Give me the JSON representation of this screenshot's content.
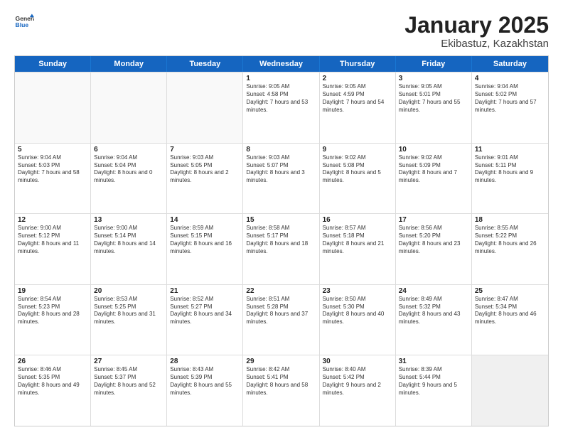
{
  "header": {
    "logo": {
      "general": "General",
      "blue": "Blue"
    },
    "title": "January 2025",
    "location": "Ekibastuz, Kazakhstan"
  },
  "weekdays": [
    "Sunday",
    "Monday",
    "Tuesday",
    "Wednesday",
    "Thursday",
    "Friday",
    "Saturday"
  ],
  "rows": [
    [
      {
        "day": "",
        "text": "",
        "empty": true
      },
      {
        "day": "",
        "text": "",
        "empty": true
      },
      {
        "day": "",
        "text": "",
        "empty": true
      },
      {
        "day": "1",
        "text": "Sunrise: 9:05 AM\nSunset: 4:58 PM\nDaylight: 7 hours and 53 minutes."
      },
      {
        "day": "2",
        "text": "Sunrise: 9:05 AM\nSunset: 4:59 PM\nDaylight: 7 hours and 54 minutes."
      },
      {
        "day": "3",
        "text": "Sunrise: 9:05 AM\nSunset: 5:01 PM\nDaylight: 7 hours and 55 minutes."
      },
      {
        "day": "4",
        "text": "Sunrise: 9:04 AM\nSunset: 5:02 PM\nDaylight: 7 hours and 57 minutes."
      }
    ],
    [
      {
        "day": "5",
        "text": "Sunrise: 9:04 AM\nSunset: 5:03 PM\nDaylight: 7 hours and 58 minutes."
      },
      {
        "day": "6",
        "text": "Sunrise: 9:04 AM\nSunset: 5:04 PM\nDaylight: 8 hours and 0 minutes."
      },
      {
        "day": "7",
        "text": "Sunrise: 9:03 AM\nSunset: 5:05 PM\nDaylight: 8 hours and 2 minutes."
      },
      {
        "day": "8",
        "text": "Sunrise: 9:03 AM\nSunset: 5:07 PM\nDaylight: 8 hours and 3 minutes."
      },
      {
        "day": "9",
        "text": "Sunrise: 9:02 AM\nSunset: 5:08 PM\nDaylight: 8 hours and 5 minutes."
      },
      {
        "day": "10",
        "text": "Sunrise: 9:02 AM\nSunset: 5:09 PM\nDaylight: 8 hours and 7 minutes."
      },
      {
        "day": "11",
        "text": "Sunrise: 9:01 AM\nSunset: 5:11 PM\nDaylight: 8 hours and 9 minutes."
      }
    ],
    [
      {
        "day": "12",
        "text": "Sunrise: 9:00 AM\nSunset: 5:12 PM\nDaylight: 8 hours and 11 minutes."
      },
      {
        "day": "13",
        "text": "Sunrise: 9:00 AM\nSunset: 5:14 PM\nDaylight: 8 hours and 14 minutes."
      },
      {
        "day": "14",
        "text": "Sunrise: 8:59 AM\nSunset: 5:15 PM\nDaylight: 8 hours and 16 minutes."
      },
      {
        "day": "15",
        "text": "Sunrise: 8:58 AM\nSunset: 5:17 PM\nDaylight: 8 hours and 18 minutes."
      },
      {
        "day": "16",
        "text": "Sunrise: 8:57 AM\nSunset: 5:18 PM\nDaylight: 8 hours and 21 minutes."
      },
      {
        "day": "17",
        "text": "Sunrise: 8:56 AM\nSunset: 5:20 PM\nDaylight: 8 hours and 23 minutes."
      },
      {
        "day": "18",
        "text": "Sunrise: 8:55 AM\nSunset: 5:22 PM\nDaylight: 8 hours and 26 minutes."
      }
    ],
    [
      {
        "day": "19",
        "text": "Sunrise: 8:54 AM\nSunset: 5:23 PM\nDaylight: 8 hours and 28 minutes."
      },
      {
        "day": "20",
        "text": "Sunrise: 8:53 AM\nSunset: 5:25 PM\nDaylight: 8 hours and 31 minutes."
      },
      {
        "day": "21",
        "text": "Sunrise: 8:52 AM\nSunset: 5:27 PM\nDaylight: 8 hours and 34 minutes."
      },
      {
        "day": "22",
        "text": "Sunrise: 8:51 AM\nSunset: 5:28 PM\nDaylight: 8 hours and 37 minutes."
      },
      {
        "day": "23",
        "text": "Sunrise: 8:50 AM\nSunset: 5:30 PM\nDaylight: 8 hours and 40 minutes."
      },
      {
        "day": "24",
        "text": "Sunrise: 8:49 AM\nSunset: 5:32 PM\nDaylight: 8 hours and 43 minutes."
      },
      {
        "day": "25",
        "text": "Sunrise: 8:47 AM\nSunset: 5:34 PM\nDaylight: 8 hours and 46 minutes."
      }
    ],
    [
      {
        "day": "26",
        "text": "Sunrise: 8:46 AM\nSunset: 5:35 PM\nDaylight: 8 hours and 49 minutes."
      },
      {
        "day": "27",
        "text": "Sunrise: 8:45 AM\nSunset: 5:37 PM\nDaylight: 8 hours and 52 minutes."
      },
      {
        "day": "28",
        "text": "Sunrise: 8:43 AM\nSunset: 5:39 PM\nDaylight: 8 hours and 55 minutes."
      },
      {
        "day": "29",
        "text": "Sunrise: 8:42 AM\nSunset: 5:41 PM\nDaylight: 8 hours and 58 minutes."
      },
      {
        "day": "30",
        "text": "Sunrise: 8:40 AM\nSunset: 5:42 PM\nDaylight: 9 hours and 2 minutes."
      },
      {
        "day": "31",
        "text": "Sunrise: 8:39 AM\nSunset: 5:44 PM\nDaylight: 9 hours and 5 minutes."
      },
      {
        "day": "",
        "text": "",
        "empty": true,
        "shaded": true
      }
    ]
  ]
}
